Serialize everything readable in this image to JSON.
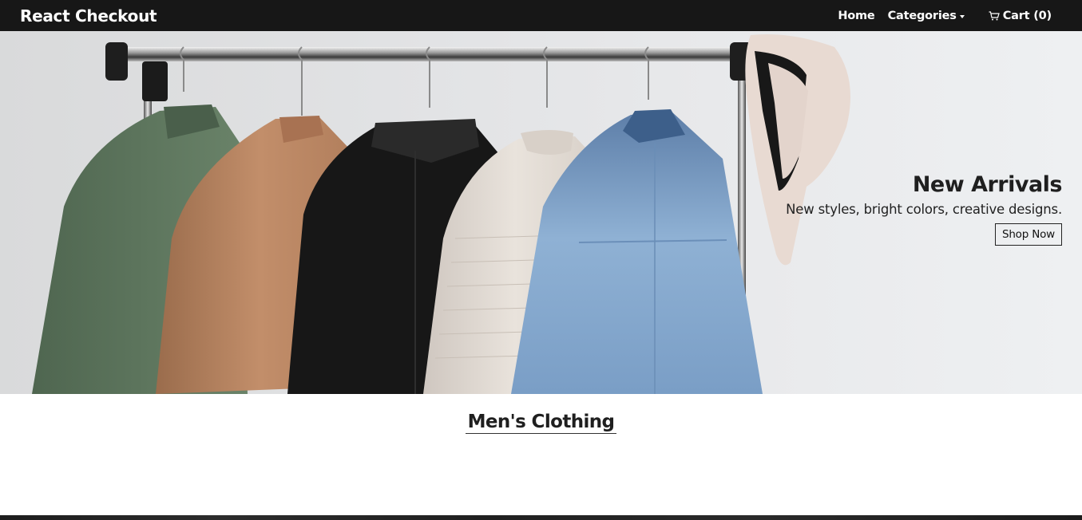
{
  "navbar": {
    "brand": "React Checkout",
    "links": [
      {
        "label": "Home"
      },
      {
        "label": "Categories"
      },
      {
        "label": "Cart (0)"
      }
    ]
  },
  "hero": {
    "title": "New Arrivals",
    "subtitle": "New styles, bright colors, creative designs.",
    "button_label": "Shop Now"
  },
  "section": {
    "title": "Men's Clothing"
  },
  "icons": [
    "cart-icon",
    "caret-down-icon"
  ],
  "colors": {
    "navbar_bg": "#171717",
    "navbar_text": "#ffffff",
    "hero_bg": "#e2e3e5",
    "text_dark": "#1f1f1f"
  }
}
